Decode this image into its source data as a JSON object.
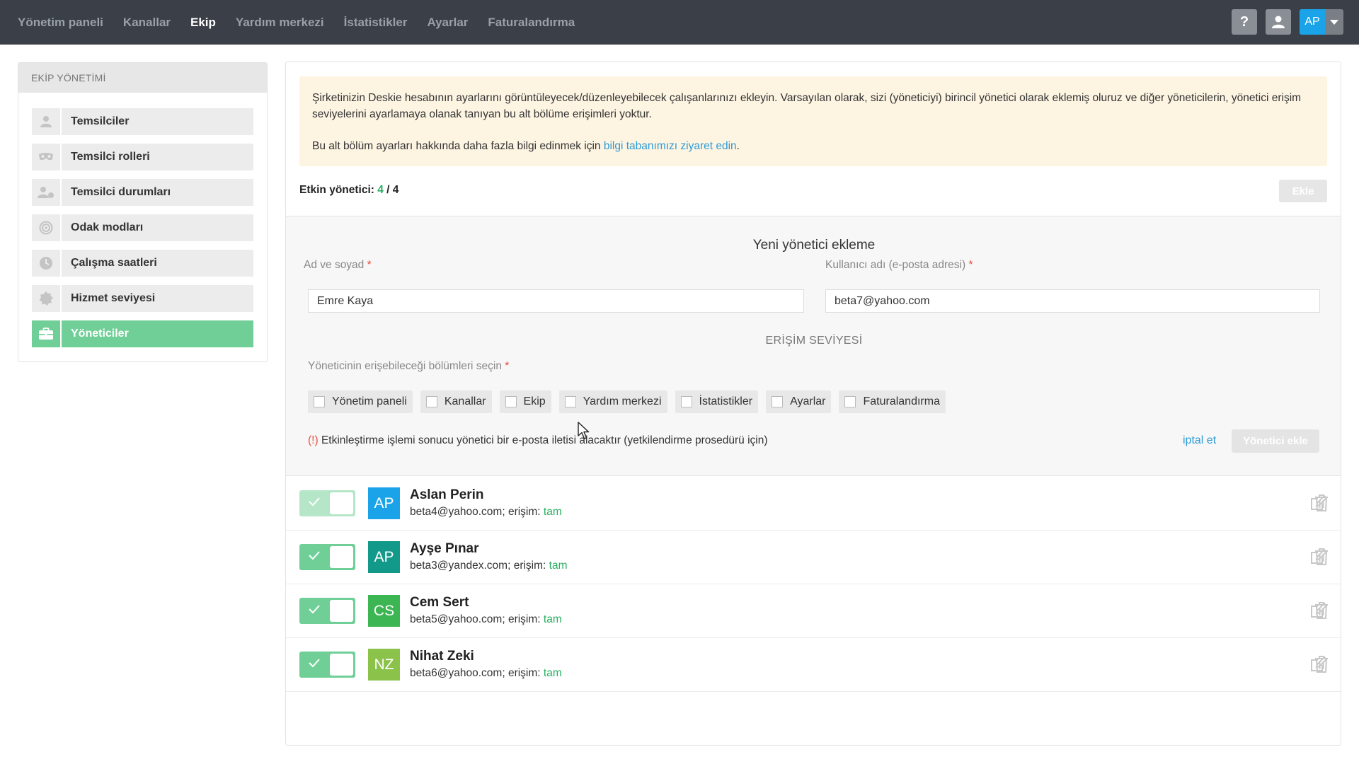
{
  "topnav": {
    "items": [
      {
        "label": "Yönetim paneli",
        "active": false
      },
      {
        "label": "Kanallar",
        "active": false
      },
      {
        "label": "Ekip",
        "active": true
      },
      {
        "label": "Yardım merkezi",
        "active": false
      },
      {
        "label": "İstatistikler",
        "active": false
      },
      {
        "label": "Ayarlar",
        "active": false
      },
      {
        "label": "Faturalandırma",
        "active": false
      }
    ],
    "help_label": "?",
    "user_initials": "AP",
    "user_avatar_color": "#1aa3e8"
  },
  "sidebar": {
    "header": "EKİP YÖNETİMİ",
    "items": [
      {
        "label": "Temsilciler",
        "icon": "person-icon"
      },
      {
        "label": "Temsilci rolleri",
        "icon": "mask-icon"
      },
      {
        "label": "Temsilci durumları",
        "icon": "person-status-icon"
      },
      {
        "label": "Odak modları",
        "icon": "target-icon"
      },
      {
        "label": "Çalışma saatleri",
        "icon": "clock-icon"
      },
      {
        "label": "Hizmet seviyesi",
        "icon": "badge-icon"
      },
      {
        "label": "Yöneticiler",
        "icon": "briefcase-icon",
        "active": true
      }
    ]
  },
  "notice": {
    "text1": "Şirketinizin Deskie hesabının ayarlarını görüntüleyecek/düzenleyebilecek çalışanlarınızı ekleyin. Varsayılan olarak, sizi (yöneticiyi) birincil yönetici olarak eklemiş oluruz ve diğer yöneticilerin, yönetici erişim seviyelerini ayarlamaya olanak tanıyan bu alt bölüme erişimleri yoktur.",
    "text2_prefix": "Bu alt bölüm ayarları hakkında daha fazla bilgi edinmek için ",
    "text2_link": "bilgi tabanımızı ziyaret edin",
    "text2_suffix": "."
  },
  "active_admins": {
    "label": "Etkin yönetici:",
    "current": "4",
    "separator": " / ",
    "total": "4"
  },
  "add_button": "Ekle",
  "form": {
    "title": "Yeni yönetici ekleme",
    "name_label": "Ad ve soyad",
    "name_value": "Emre Kaya",
    "email_label": "Kullanıcı adı (e-posta adresi)",
    "email_value": "beta7@yahoo.com",
    "required_mark": "*",
    "access_title": "ERİŞİM SEVİYESİ",
    "sections_label": "Yöneticinin erişebileceği bölümleri seçin",
    "checkboxes": [
      "Yönetim paneli",
      "Kanallar",
      "Ekip",
      "Yardım merkezi",
      "İstatistikler",
      "Ayarlar",
      "Faturalandırma"
    ],
    "warning_mark": "(!)",
    "warning_text": " Etkinleştirme işlemi sonucu yönetici bir e-posta iletisi alacaktır (yetkilendirme prosedürü için)",
    "cancel_label": "iptal et",
    "submit_label": "Yönetici ekle"
  },
  "admins": [
    {
      "name": "Aslan Perin",
      "initials": "AP",
      "email": "beta4@yahoo.com; erişim: ",
      "level": "tam",
      "avatar_color": "#1aa3e8",
      "enabled": true,
      "dim": true
    },
    {
      "name": "Ayşe Pınar",
      "initials": "AP",
      "email": "beta3@yandex.com; erişim: ",
      "level": "tam",
      "avatar_color": "#12998a",
      "enabled": true,
      "dim": false
    },
    {
      "name": "Cem Sert",
      "initials": "CS",
      "email": "beta5@yahoo.com; erişim: ",
      "level": "tam",
      "avatar_color": "#3cb553",
      "enabled": true,
      "dim": false
    },
    {
      "name": "Nihat Zeki",
      "initials": "NZ",
      "email": "beta6@yahoo.com; erişim: ",
      "level": "tam",
      "avatar_color": "#8bc34a",
      "enabled": true,
      "dim": false
    }
  ],
  "colors": {
    "topbar": "#3a3f48",
    "accent_green": "#6fcf97",
    "link_blue": "#2f9bd6",
    "notice_bg": "#fdf4e2"
  }
}
